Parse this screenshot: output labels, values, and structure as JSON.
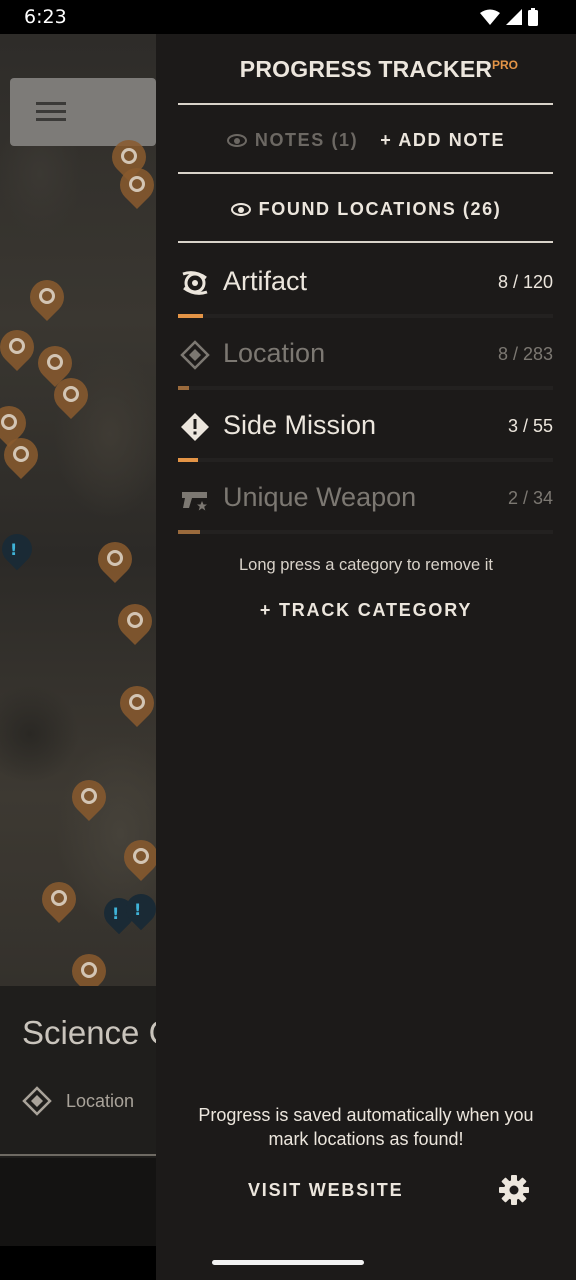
{
  "status_bar": {
    "time": "6:23"
  },
  "map": {
    "bottom_sheet": {
      "title": "Science C",
      "type_label": "Location"
    }
  },
  "drawer": {
    "title": "PROGRESS TRACKER",
    "badge": "PRO",
    "notes_label": "NOTES (1)",
    "add_note_label": "+ ADD NOTE",
    "found_label": "FOUND LOCATIONS (26)",
    "categories": [
      {
        "name": "Artifact",
        "count": "8 / 120",
        "progress": 0.0667,
        "icon": "artifact-icon",
        "state": "active"
      },
      {
        "name": "Location",
        "count": "8 / 283",
        "progress": 0.0283,
        "icon": "location-diamond-icon",
        "state": "inactive"
      },
      {
        "name": "Side Mission",
        "count": "3 / 55",
        "progress": 0.0545,
        "icon": "side-mission-icon",
        "state": "active"
      },
      {
        "name": "Unique Weapon",
        "count": "2 / 34",
        "progress": 0.0588,
        "icon": "unique-weapon-icon",
        "state": "inactive"
      }
    ],
    "hint": "Long press a category to remove it",
    "track_category_label": "+ TRACK CATEGORY",
    "saved_note": "Progress is saved automatically when you mark locations as found!",
    "visit_label": "VISIT WEBSITE"
  },
  "colors": {
    "accent": "#e39446",
    "accent_dim": "#9a6a3c",
    "background": "#1c1a19"
  }
}
